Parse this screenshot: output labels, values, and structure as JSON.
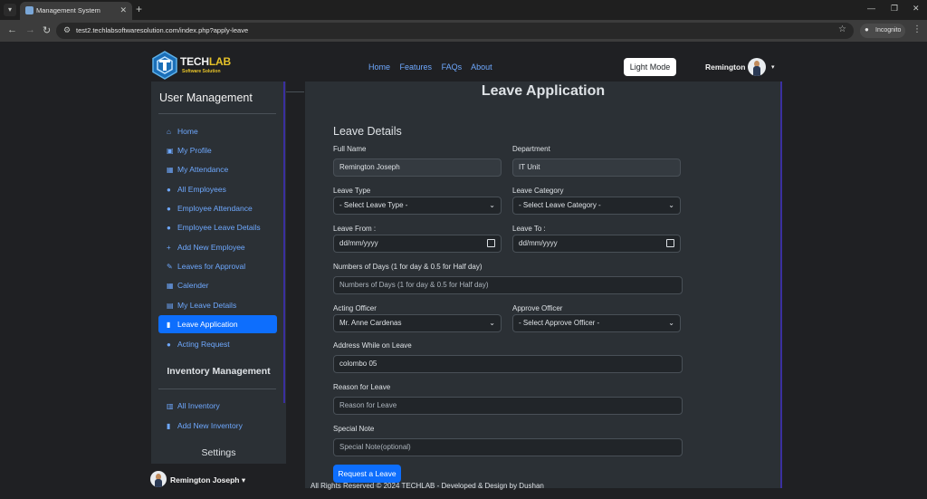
{
  "browser": {
    "tab_title": "Management System",
    "url": "test2.techlabsoftwaresolution.com/index.php?apply-leave",
    "incognito_label": "Incognito",
    "icons": [
      "tab-list-icon",
      "new-tab-icon",
      "minimize-icon",
      "maximize-icon",
      "close-icon",
      "back-icon",
      "forward-icon",
      "reload-icon",
      "site-info-icon",
      "bookmark-star-icon",
      "incognito-icon",
      "menu-icon"
    ]
  },
  "header": {
    "logo_tech": "TECH",
    "logo_lab": "LAB",
    "logo_sub": "Software Solution",
    "nav": [
      "Home",
      "Features",
      "FAQs",
      "About"
    ],
    "theme_button": "Light Mode",
    "user_name": "Remington"
  },
  "sidebar": {
    "title": "User Management",
    "items": [
      {
        "label": "Home",
        "icon": "home-icon"
      },
      {
        "label": "My Profile",
        "icon": "id-card-icon"
      },
      {
        "label": "My Attendance",
        "icon": "calendar-icon"
      },
      {
        "label": "All Employees",
        "icon": "user-icon"
      },
      {
        "label": "Employee Attendance",
        "icon": "user-icon"
      },
      {
        "label": "Employee Leave Details",
        "icon": "user-icon"
      },
      {
        "label": "Add New Employee",
        "icon": "user-plus-icon"
      },
      {
        "label": "Leaves for Approval",
        "icon": "edit-icon"
      },
      {
        "label": "Calender",
        "icon": "calendar-icon"
      },
      {
        "label": "My Leave Details",
        "icon": "table-icon"
      },
      {
        "label": "Leave Application",
        "icon": "file-icon",
        "active": true
      },
      {
        "label": "Acting Request",
        "icon": "user-gear-icon"
      }
    ],
    "inventory_title": "Inventory Management",
    "inventory_items": [
      {
        "label": "All Inventory",
        "icon": "building-icon"
      },
      {
        "label": "Add New Inventory",
        "icon": "file-plus-icon"
      }
    ],
    "settings_title": "Settings",
    "user_name": "Remington Joseph"
  },
  "main": {
    "page_title": "Leave Application",
    "form_title": "Leave Details",
    "full_name_label": "Full Name",
    "full_name_value": "Remington  Joseph",
    "department_label": "Department",
    "department_value": "IT Unit",
    "leave_type_label": "Leave Type",
    "leave_type_value": "- Select Leave Type -",
    "leave_category_label": "Leave Category",
    "leave_category_value": "- Select Leave Category -",
    "leave_from_label": "Leave From :",
    "leave_from_placeholder": "dd/mm/yyyy",
    "leave_to_label": "Leave To :",
    "leave_to_placeholder": "dd/mm/yyyy",
    "num_days_label": "Numbers of Days (1 for day & 0.5 for Half day)",
    "num_days_placeholder": "Numbers of Days   (1 for day & 0.5 for Half day)",
    "acting_officer_label": "Acting Officer",
    "acting_officer_value": "Mr. Anne Cardenas",
    "approve_officer_label": "Approve Officer",
    "approve_officer_value": "- Select Approve Officer -",
    "address_label": "Address While on Leave",
    "address_value": "colombo 05",
    "reason_label": "Reason for Leave",
    "reason_placeholder": "Reason for Leave",
    "note_label": "Special Note",
    "note_placeholder": "Special Note(optional)",
    "submit_label": "Request a Leave"
  },
  "footer": {
    "text": "All Rights Reserved © 2024 TECHLAB - Developed & Design by Dushan"
  },
  "colors": {
    "accent": "#0d6efd",
    "link": "#6ea8fe",
    "panel": "#2b3035",
    "page_bg": "#1f2023",
    "logo_gold": "#e6c229"
  }
}
